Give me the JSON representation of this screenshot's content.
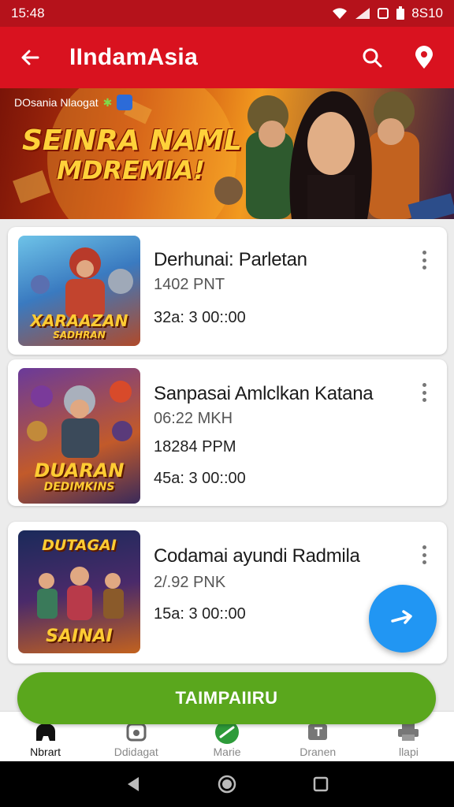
{
  "status_bar": {
    "time": "15:48",
    "right_text": "8S10"
  },
  "app_bar": {
    "title": "IIndamAsia",
    "icons": [
      "back-arrow-icon",
      "search-icon",
      "location-pin-icon"
    ]
  },
  "banner": {
    "top_text": "DOsania Nlaogat",
    "headline_line1": "SEINRA NAML",
    "headline_line2": "MDREMIA!"
  },
  "cards": [
    {
      "thumb_caption": "XARAAZAN",
      "thumb_subcaption": "SADHRAN",
      "title": "Derhunai: Parletan",
      "line1": "1402 PNT",
      "line2": "",
      "line3": "32a: 3 00::00"
    },
    {
      "thumb_caption": "DUARAN",
      "thumb_subcaption": "DEDIMKINS",
      "title": "Sanpasai Amlclkan Katana",
      "line1": "06:22 MKH",
      "line2": "18284 PPM",
      "line3": "45a: 3 00::00"
    },
    {
      "thumb_top": "DUTAGAI",
      "thumb_caption": "SAINAI",
      "title": "Codamai ayundi Radmila",
      "line1": "2/.92 PNK",
      "line2": "",
      "line3": "15a: 3 00::00"
    }
  ],
  "cta_label": "TAIMPAIIRU",
  "bottom_nav": [
    {
      "label": "Nbrart",
      "icon": "home-icon",
      "active": true
    },
    {
      "label": "Ddidagat",
      "icon": "gamepad-icon",
      "active": false
    },
    {
      "label": "Marie",
      "icon": "compass-icon",
      "active": false
    },
    {
      "label": "Dranen",
      "icon": "ticket-icon",
      "active": false
    },
    {
      "label": "llapi",
      "icon": "printer-icon",
      "active": false
    }
  ],
  "colors": {
    "primary_red": "#d9121f",
    "cta_green": "#5aa71d",
    "fab_blue": "#2196f3"
  }
}
